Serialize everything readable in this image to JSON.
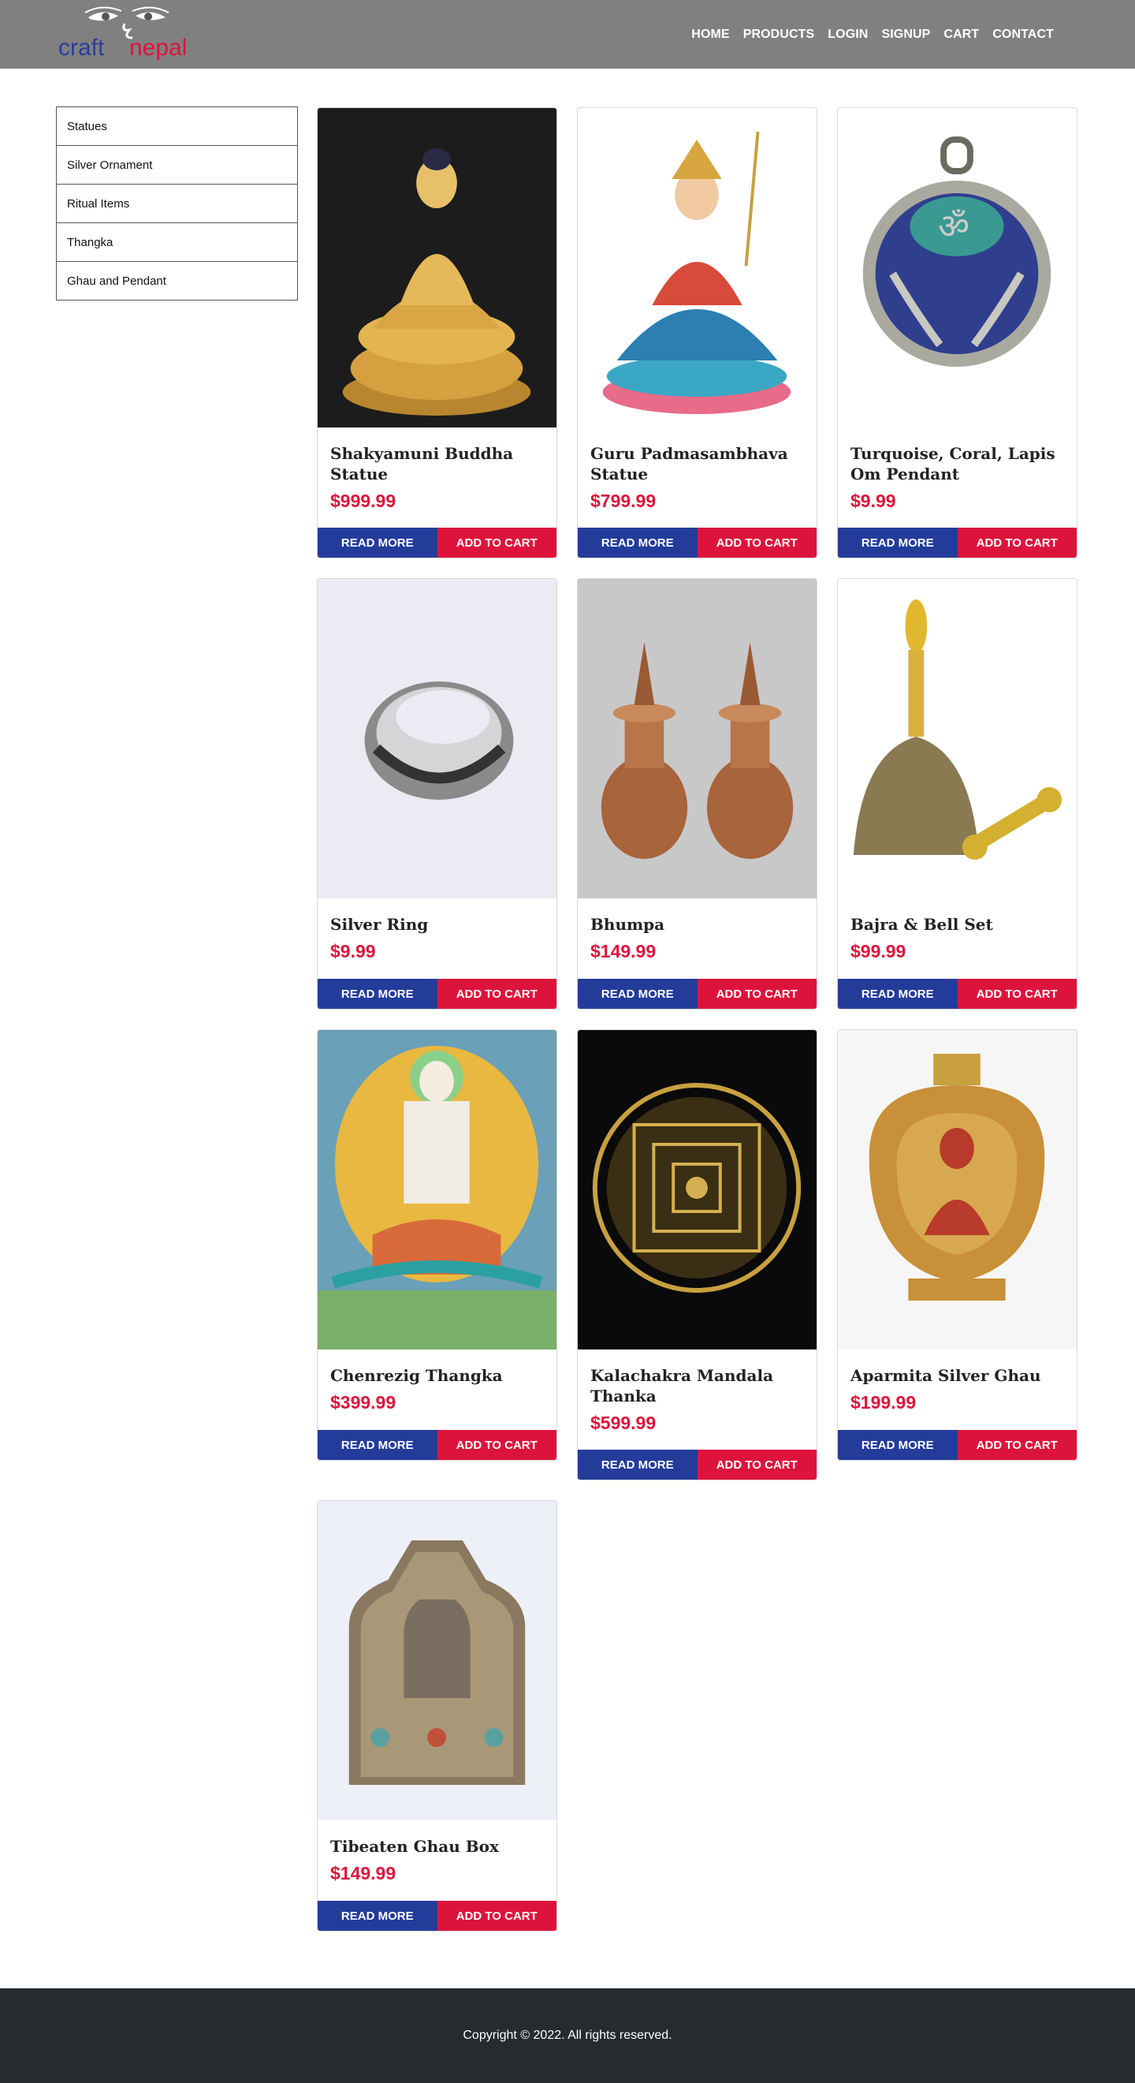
{
  "brand": {
    "name_part1": "craft",
    "name_part2": "nepal",
    "color1": "#2a3d9a",
    "color2": "#dc143c"
  },
  "nav": {
    "home": "HOME",
    "products": "PRODUCTS",
    "login": "LOGIN",
    "signup": "SIGNUP",
    "cart": "CART",
    "contact": "CONTACT"
  },
  "sidebar": {
    "items": [
      {
        "label": "Statues"
      },
      {
        "label": "Silver Ornament"
      },
      {
        "label": "Ritual Items"
      },
      {
        "label": "Thangka"
      },
      {
        "label": "Ghau and Pendant"
      }
    ]
  },
  "buttons": {
    "read_more": "READ MORE",
    "add_to_cart": "ADD TO CART"
  },
  "products": [
    {
      "title": "Shakyamuni Buddha Statue",
      "price": "$999.99",
      "image": "golden-buddha-statue"
    },
    {
      "title": "Guru Padmasambhava Statue",
      "price": "$799.99",
      "image": "painted-padmasambhava-statue"
    },
    {
      "title": "Turquoise, Coral, Lapis Om Pendant",
      "price": "$9.99",
      "image": "om-pendant"
    },
    {
      "title": "Silver Ring",
      "price": "$9.99",
      "image": "silver-ring"
    },
    {
      "title": "Bhumpa",
      "price": "$149.99",
      "image": "copper-bhumpa-pair"
    },
    {
      "title": "Bajra & Bell Set",
      "price": "$99.99",
      "image": "bell-and-vajra"
    },
    {
      "title": "Chenrezig Thangka",
      "price": "$399.99",
      "image": "chenrezig-thangka"
    },
    {
      "title": "Kalachakra Mandala Thanka",
      "price": "$599.99",
      "image": "kalachakra-mandala"
    },
    {
      "title": "Aparmita Silver Ghau",
      "price": "$199.99",
      "image": "aparmita-ghau"
    },
    {
      "title": "Tibeaten Ghau Box",
      "price": "$149.99",
      "image": "tibetan-ghau-box"
    }
  ],
  "footer": {
    "copyright": "Copyright © 2022. All rights reserved."
  },
  "colors": {
    "header_bg": "#808080",
    "read_more": "#233c9a",
    "add_to_cart": "#dc143c",
    "price": "#dc143c",
    "footer_bg": "#262b2f"
  }
}
